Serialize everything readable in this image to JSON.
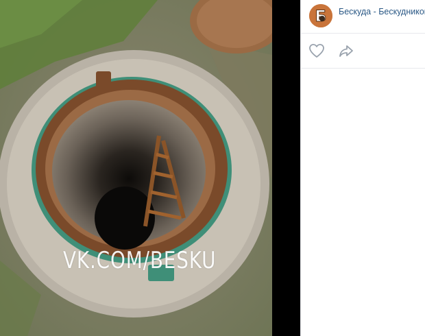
{
  "photo": {
    "watermark": "VK.COM/BESKU",
    "description_icon": "manhole-photo"
  },
  "post": {
    "group_name": "Бескуда - Бескудниково",
    "avatar_icon": "group-avatar-icon"
  },
  "actions": {
    "like_icon": "heart-icon",
    "share_icon": "share-arrow-icon"
  },
  "colors": {
    "link": "#2a5885",
    "icon": "#99a2ad",
    "divider": "#e7e8ec",
    "viewer_gap": "#000000"
  }
}
